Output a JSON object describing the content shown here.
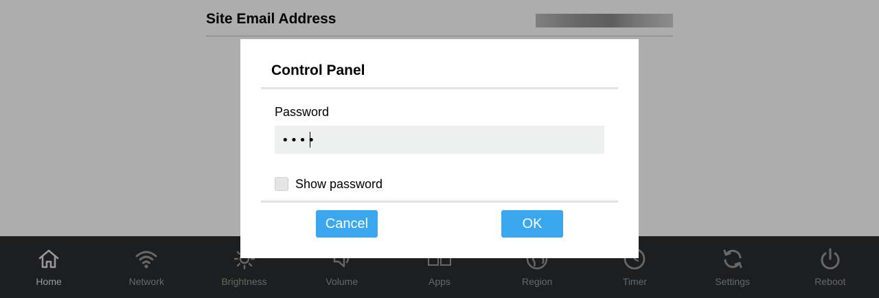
{
  "background": {
    "row_label": "Site Email Address"
  },
  "navbar": {
    "items": [
      {
        "label": "Home",
        "icon": "home-icon"
      },
      {
        "label": "Network",
        "icon": "wifi-icon"
      },
      {
        "label": "Brightness",
        "icon": "sun-icon"
      },
      {
        "label": "Volume",
        "icon": "speaker-icon"
      },
      {
        "label": "Apps",
        "icon": "apps-grid-icon"
      },
      {
        "label": "Region",
        "icon": "globe-icon"
      },
      {
        "label": "Timer",
        "icon": "clock-icon"
      },
      {
        "label": "Settings",
        "icon": "refresh-icon"
      },
      {
        "label": "Reboot",
        "icon": "power-icon"
      }
    ],
    "active": "Home"
  },
  "dialog": {
    "title": "Control Panel",
    "password_label": "Password",
    "password_masked": "••••",
    "show_password_label": "Show password",
    "show_password_checked": false,
    "cancel_label": "Cancel",
    "ok_label": "OK"
  },
  "colors": {
    "button": "#3ba7ef",
    "navbar": "#2b2d30",
    "input_bg": "#eef0ef"
  }
}
